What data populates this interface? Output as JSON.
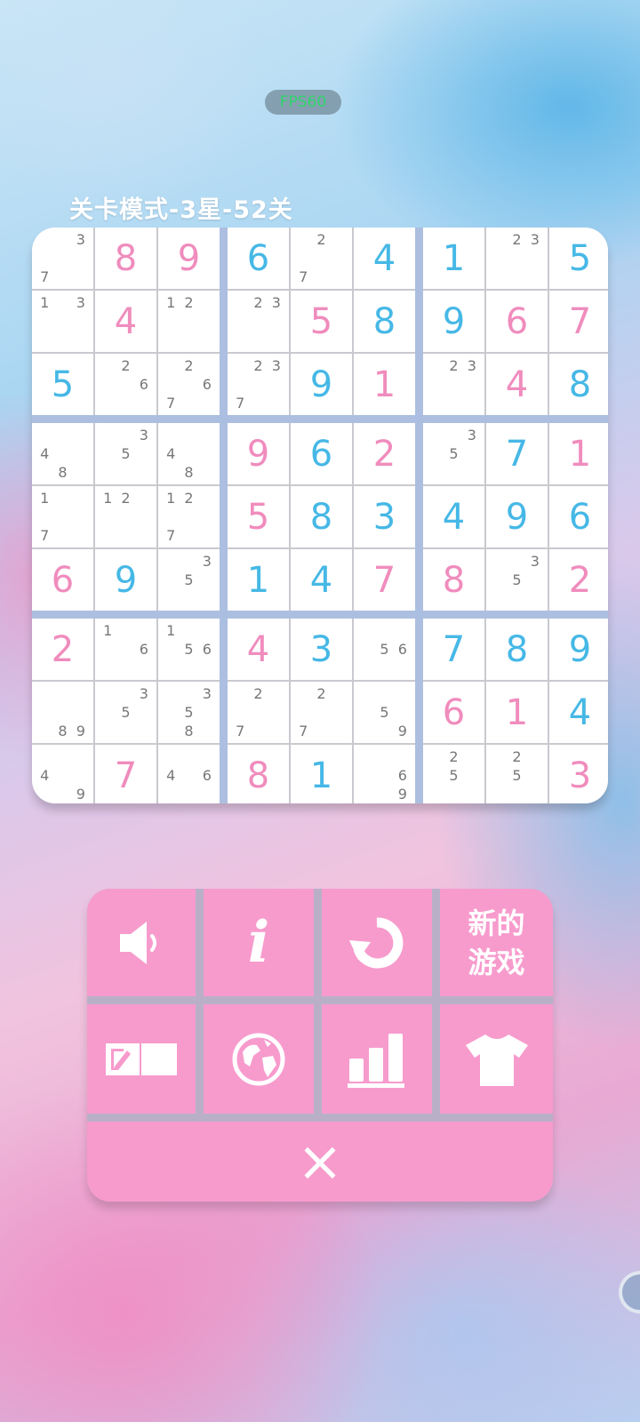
{
  "fps": "FPS60",
  "title": "关卡模式-3星-52关",
  "colors": {
    "given": "#46b8e6",
    "entered": "#f08cbd",
    "notes": "#777777",
    "panel": "#f79bcd"
  },
  "grid": [
    [
      {
        "n": "3 7"
      },
      {
        "v": "8",
        "c": "pink"
      },
      {
        "v": "9",
        "c": "pink"
      },
      {
        "v": "6",
        "c": "blue"
      },
      {
        "n": "2 7"
      },
      {
        "v": "4",
        "c": "blue"
      },
      {
        "v": "1",
        "c": "blue"
      },
      {
        "n": "23"
      },
      {
        "v": "5",
        "c": "blue"
      }
    ],
    [
      {
        "n": "13"
      },
      {
        "v": "4",
        "c": "pink"
      },
      {
        "n": "12"
      },
      {
        "n": "23"
      },
      {
        "v": "5",
        "c": "pink"
      },
      {
        "v": "8",
        "c": "blue"
      },
      {
        "v": "9",
        "c": "blue"
      },
      {
        "v": "6",
        "c": "pink"
      },
      {
        "v": "7",
        "c": "pink"
      }
    ],
    [
      {
        "v": "5",
        "c": "blue"
      },
      {
        "n": "26"
      },
      {
        "n": "267"
      },
      {
        "n": "237"
      },
      {
        "v": "9",
        "c": "blue"
      },
      {
        "v": "1",
        "c": "pink"
      },
      {
        "n": "23"
      },
      {
        "v": "4",
        "c": "pink"
      },
      {
        "v": "8",
        "c": "blue"
      }
    ],
    [
      {
        "n": "48"
      },
      {
        "n": "35"
      },
      {
        "n": "48"
      },
      {
        "v": "9",
        "c": "pink"
      },
      {
        "v": "6",
        "c": "blue"
      },
      {
        "v": "2",
        "c": "pink"
      },
      {
        "n": "35"
      },
      {
        "v": "7",
        "c": "blue"
      },
      {
        "v": "1",
        "c": "pink"
      }
    ],
    [
      {
        "n": "17"
      },
      {
        "n": "12"
      },
      {
        "n": "127"
      },
      {
        "v": "5",
        "c": "pink"
      },
      {
        "v": "8",
        "c": "blue"
      },
      {
        "v": "3",
        "c": "blue"
      },
      {
        "v": "4",
        "c": "blue"
      },
      {
        "v": "9",
        "c": "blue"
      },
      {
        "v": "6",
        "c": "blue"
      }
    ],
    [
      {
        "v": "6",
        "c": "pink"
      },
      {
        "v": "9",
        "c": "blue"
      },
      {
        "n": "35"
      },
      {
        "v": "1",
        "c": "blue"
      },
      {
        "v": "4",
        "c": "blue"
      },
      {
        "v": "7",
        "c": "pink"
      },
      {
        "v": "8",
        "c": "pink"
      },
      {
        "n": "35"
      },
      {
        "v": "2",
        "c": "pink"
      }
    ],
    [
      {
        "v": "2",
        "c": "pink"
      },
      {
        "n": "16"
      },
      {
        "n": "156"
      },
      {
        "v": "4",
        "c": "pink"
      },
      {
        "v": "3",
        "c": "blue"
      },
      {
        "n": "56"
      },
      {
        "v": "7",
        "c": "blue"
      },
      {
        "v": "8",
        "c": "blue"
      },
      {
        "v": "9",
        "c": "blue"
      }
    ],
    [
      {
        "n": "89"
      },
      {
        "n": "35"
      },
      {
        "n": "358"
      },
      {
        "n": "27"
      },
      {
        "n": "27"
      },
      {
        "n": "59"
      },
      {
        "v": "6",
        "c": "pink"
      },
      {
        "v": "1",
        "c": "pink"
      },
      {
        "v": "4",
        "c": "blue"
      }
    ],
    [
      {
        "n": "49"
      },
      {
        "v": "7",
        "c": "pink"
      },
      {
        "n": "46"
      },
      {
        "v": "8",
        "c": "pink"
      },
      {
        "v": "1",
        "c": "blue"
      },
      {
        "n": "69"
      },
      {
        "n": "25"
      },
      {
        "n": "25"
      },
      {
        "v": "3",
        "c": "pink"
      }
    ]
  ],
  "panel": {
    "buttons": [
      {
        "name": "sound-button",
        "icon": "speaker-icon"
      },
      {
        "name": "info-button",
        "icon": "info-icon",
        "label": "i"
      },
      {
        "name": "restart-button",
        "icon": "refresh-icon"
      },
      {
        "name": "new-game-button",
        "label": "新的\n游戏"
      },
      {
        "name": "notes-button",
        "icon": "pencil-notes-icon"
      },
      {
        "name": "language-button",
        "icon": "globe-icon"
      },
      {
        "name": "stats-button",
        "icon": "bar-chart-icon"
      },
      {
        "name": "theme-button",
        "icon": "tshirt-icon"
      }
    ],
    "close_label": "×"
  }
}
